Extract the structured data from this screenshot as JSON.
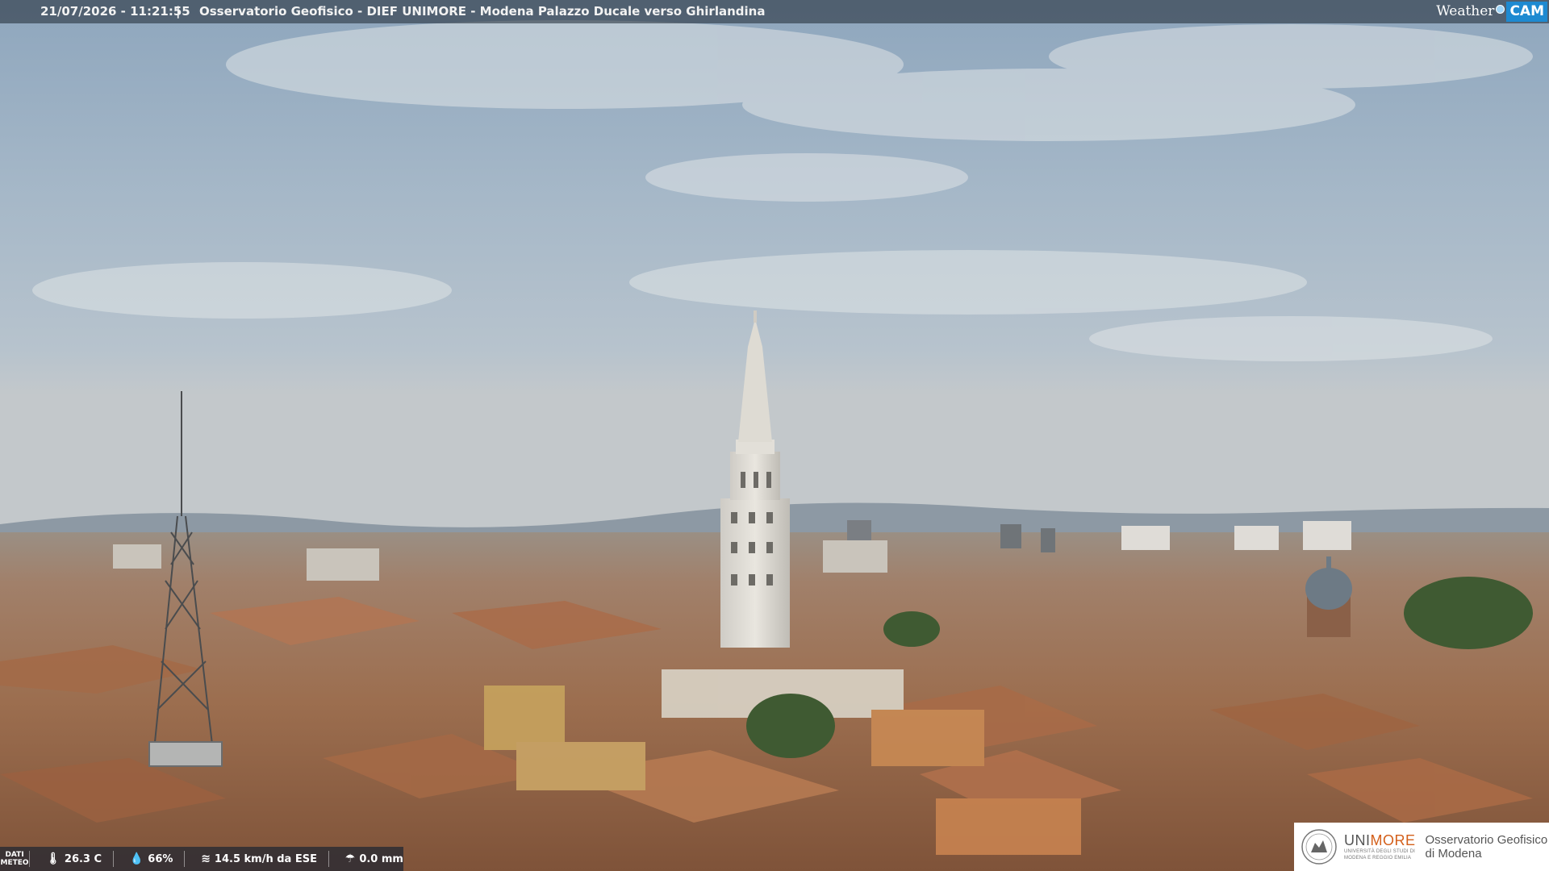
{
  "caption": {
    "timestamp": "21/07/2026 - 11:21:55",
    "separator": "|",
    "title": "Osservatorio Geofisico - DIEF UNIMORE - Modena Palazzo Ducale verso Ghirlandina"
  },
  "weathercam_logo": {
    "word1": "Weather",
    "word2": "CAM",
    "accent_color": "#1e8ad1"
  },
  "meteo": {
    "label_line1": "DATI",
    "label_line2": "METEO",
    "temperature": "26.3 C",
    "humidity": "66%",
    "wind": "14.5 km/h da ESE",
    "rain": "0.0 mm",
    "icons": {
      "temperature": "thermometer-icon",
      "humidity": "drop-icon",
      "wind": "wind-icon",
      "rain": "umbrella-icon"
    }
  },
  "unimore_logo": {
    "name_part1": "UNI",
    "name_part2": "MORE",
    "sub_line1": "UNIVERSITÀ DEGLI STUDI DI",
    "sub_line2": "MODENA E REGGIO EMILIA",
    "observatory_line1": "Osservatorio Geofisico",
    "observatory_line2": "di Modena",
    "brand_color": "#d35f1a"
  }
}
